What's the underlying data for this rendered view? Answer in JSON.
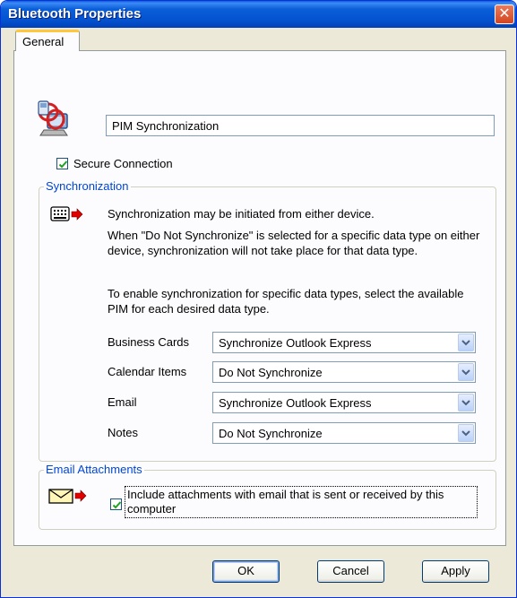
{
  "window": {
    "title": "Bluetooth Properties",
    "close_glyph": "✕"
  },
  "tabs": [
    {
      "label": "General",
      "active": true
    }
  ],
  "general": {
    "profile_name": "PIM Synchronization",
    "secure_connection": {
      "label": "Secure Connection",
      "checked": true
    }
  },
  "synchronization": {
    "legend": "Synchronization",
    "line1": "Synchronization may be initiated from either device.",
    "line2": "When \"Do Not Synchronize\" is selected for a specific data type on either device, synchronization will not take place for that data type.",
    "line3": "To enable synchronization for specific data types, select the available PIM for each desired data type.",
    "rows": [
      {
        "label": "Business Cards",
        "value": "Synchronize Outlook Express"
      },
      {
        "label": "Calendar Items",
        "value": "Do Not Synchronize"
      },
      {
        "label": "Email",
        "value": "Synchronize Outlook Express"
      },
      {
        "label": "Notes",
        "value": "Do Not Synchronize"
      }
    ]
  },
  "email_attachments": {
    "legend": "Email Attachments",
    "include_label": "Include attachments with email that is sent or received by this computer",
    "checked": true
  },
  "buttons": {
    "ok": "OK",
    "cancel": "Cancel",
    "apply": "Apply"
  },
  "colors": {
    "title_bar": "#0a5fd8",
    "group_legend": "#0046d5",
    "close_button": "#d3451f",
    "tab_highlight": "#ffc83c"
  },
  "icons": [
    "pim-sync-icon",
    "sync-device-icon",
    "arrow-right-icon",
    "envelope-icon",
    "checkmark-icon",
    "dropdown-arrow-icon"
  ]
}
